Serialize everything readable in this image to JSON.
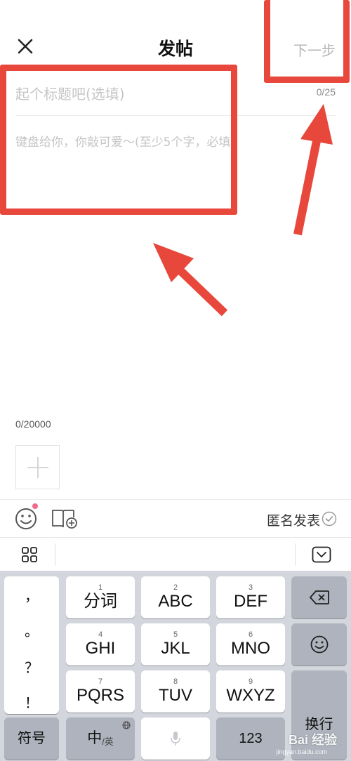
{
  "header": {
    "title": "发帖",
    "next_label": "下一步",
    "close_icon": "close-icon"
  },
  "editor": {
    "title_placeholder": "起个标题吧(选填)",
    "title_count": "0/25",
    "body_placeholder": "键盘给你，你敲可爱～(至少5个字，必填)",
    "body_count": "0/20000"
  },
  "toolbar": {
    "anonymous_label": "匿名发表"
  },
  "keyboard": {
    "punctuation": [
      "，",
      "。",
      "？",
      "！"
    ],
    "keys": [
      {
        "num": "1",
        "label": "分词"
      },
      {
        "num": "2",
        "label": "ABC"
      },
      {
        "num": "3",
        "label": "DEF"
      },
      {
        "num": "4",
        "label": "GHI"
      },
      {
        "num": "5",
        "label": "JKL"
      },
      {
        "num": "6",
        "label": "MNO"
      },
      {
        "num": "7",
        "label": "PQRS"
      },
      {
        "num": "8",
        "label": "TUV"
      },
      {
        "num": "9",
        "label": "WXYZ"
      }
    ],
    "symbols_label": "符号",
    "lang_main": "中",
    "lang_sub": "/英",
    "numbers_label": "123",
    "enter_label": "换行"
  },
  "watermark": {
    "text": "Bai 经验",
    "sub": "jingyan.baidu.com"
  },
  "colors": {
    "annotation": "#e8483c",
    "keyboard_bg": "#d3d6dd",
    "dark_key": "#aeb3bd"
  }
}
